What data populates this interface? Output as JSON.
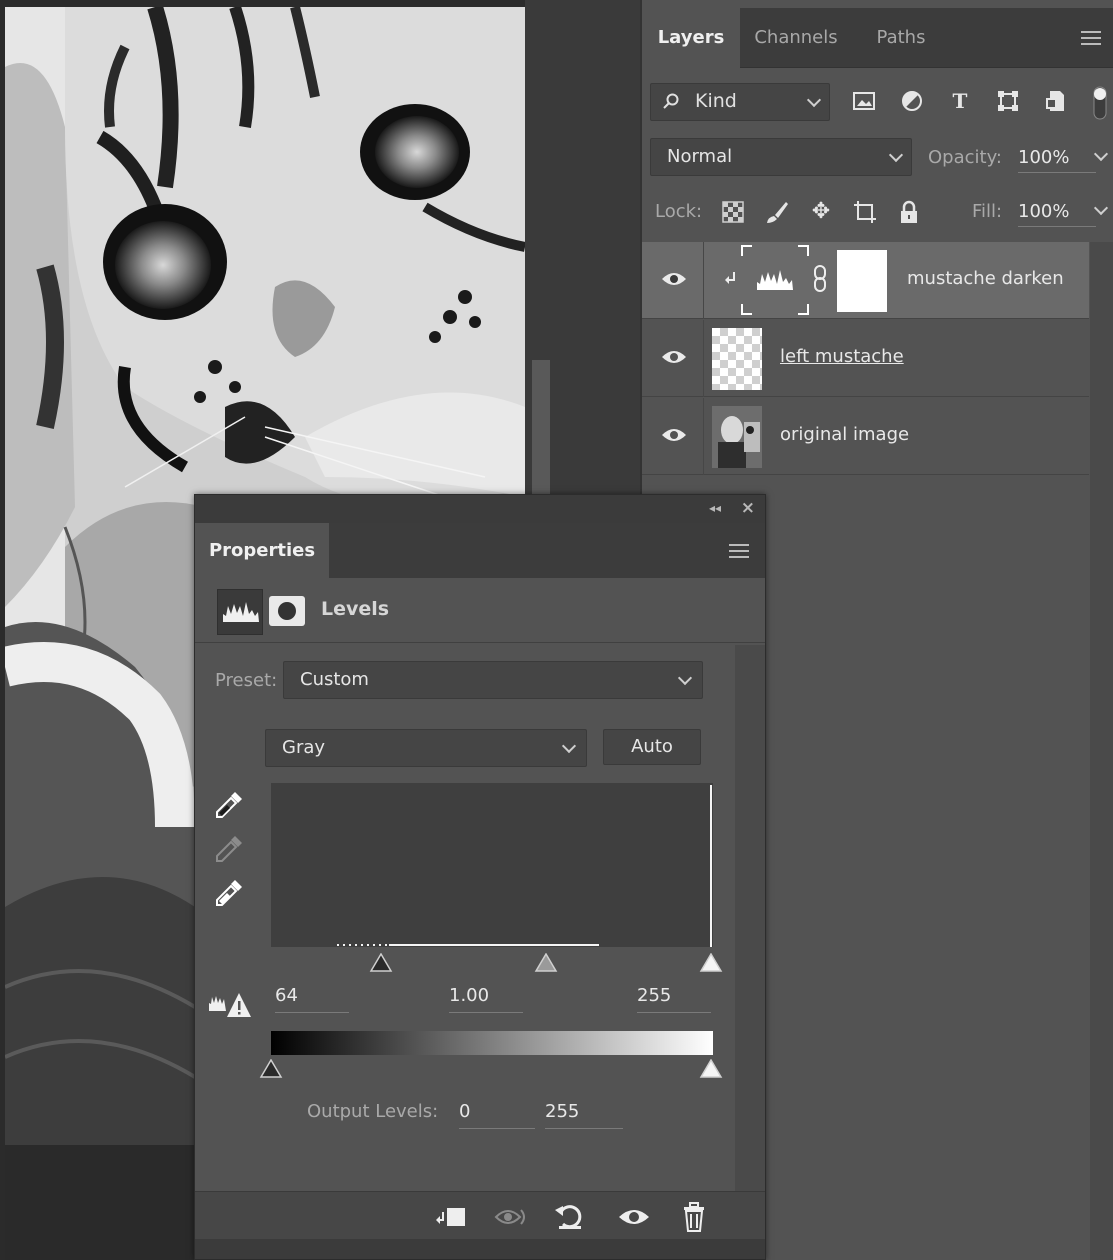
{
  "layers_panel": {
    "tabs": [
      "Layers",
      "Channels",
      "Paths"
    ],
    "filter": {
      "label": "Kind"
    },
    "blend_mode": "Normal",
    "opacity_label": "Opacity:",
    "opacity_value": "100%",
    "lock_label": "Lock:",
    "fill_label": "Fill:",
    "fill_value": "100%",
    "layers": [
      {
        "name": "mustache darken",
        "visible": true,
        "selected": true,
        "type": "levels-adjustment"
      },
      {
        "name": "left mustache",
        "visible": true,
        "selected": false,
        "type": "pixel"
      },
      {
        "name": "original image",
        "visible": true,
        "selected": false,
        "type": "pixel"
      }
    ]
  },
  "properties_panel": {
    "tab": "Properties",
    "title": "Levels",
    "preset_label": "Preset:",
    "preset_value": "Custom",
    "channel_value": "Gray",
    "auto_label": "Auto",
    "input_levels": {
      "black": "64",
      "gamma": "1.00",
      "white": "255"
    },
    "output_label": "Output Levels:",
    "output_levels": {
      "black": "0",
      "white": "255"
    }
  },
  "colors": {
    "panel_bg": "#535353",
    "tab_bar_bg": "#3c3c3c",
    "field_bg": "#454545",
    "selected_layer": "#6a6a6a"
  }
}
